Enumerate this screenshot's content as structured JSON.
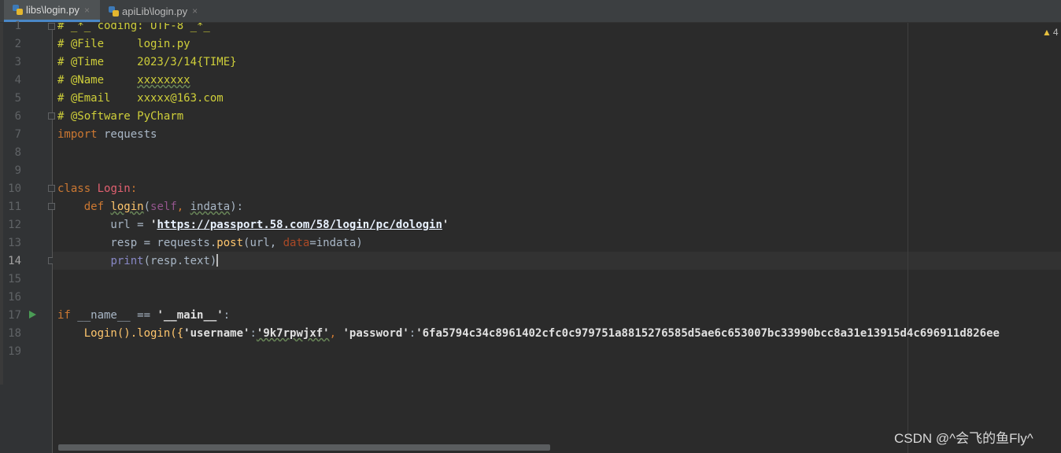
{
  "tabs": [
    {
      "label": "libs\\login.py",
      "active": true,
      "close": "×"
    },
    {
      "label": "apiLib\\login.py",
      "active": false,
      "close": "×"
    }
  ],
  "line_numbers": [
    "1",
    "2",
    "3",
    "4",
    "5",
    "6",
    "7",
    "8",
    "9",
    "10",
    "11",
    "12",
    "13",
    "14",
    "15",
    "16",
    "17",
    "18",
    "19"
  ],
  "current_line": "14",
  "code": {
    "l1": "# _*_ coding: UTF-8 _*_",
    "l2": "# @File     login.py",
    "l3": "# @Time     2023/3/14{TIME}",
    "l4a": "# @Name     ",
    "l4b": "xxxxxxxx",
    "l5": "# @Email    xxxxx@163.com",
    "l6": "# @Software PyCharm",
    "l7_kw": "import",
    "l7_rest": " requests",
    "l10_kw": "class",
    "l10_name": "Login",
    "l10_colon": ":",
    "l11_indent": "    ",
    "l11_kw": "def",
    "l11_fn": "login",
    "l11_open": "(",
    "l11_self": "self",
    "l11_comma": ", ",
    "l11_param": "indata",
    "l11_close": "):",
    "l12_pre": "        url = ",
    "l12_q1": "'",
    "l12_url": "https://passport.58.com/58/login/pc/dologin",
    "l12_q2": "'",
    "l13_pre": "        resp = requests.",
    "l13_fn": "post",
    "l13_a": "(url, ",
    "l13_kwarg": "data",
    "l13_b": "=indata)",
    "l14_pre": "        ",
    "l14_fn": "print",
    "l14_arg": "(resp.text)",
    "l17_kw": "if",
    "l17_a": " __name__ == ",
    "l17_str": "'__main__'",
    "l17_colon": ":",
    "l18_pre": "    Login().login({",
    "l18_k1": "'username'",
    "l18_c1": ":",
    "l18_v1": "'9k7rpwjxf'",
    "l18_c2": ", ",
    "l18_k2": "'password'",
    "l18_c3": ":",
    "l18_v2": "'6fa5794c34c8961402cfc0c979751a8815276585d5ae6c653007bc33990bcc8a31e13915d4c696911d826ee"
  },
  "warnings": {
    "symbol": "▲",
    "count": "4"
  },
  "watermark": "CSDN @^会飞的鱼Fly^",
  "colors": {
    "background": "#2b2b2b",
    "gutter": "#313335",
    "comment": "#cfcf3a",
    "keyword": "#cc7832",
    "function": "#ffc66d",
    "string": "#6a8759",
    "accent": "#4a88c7"
  }
}
